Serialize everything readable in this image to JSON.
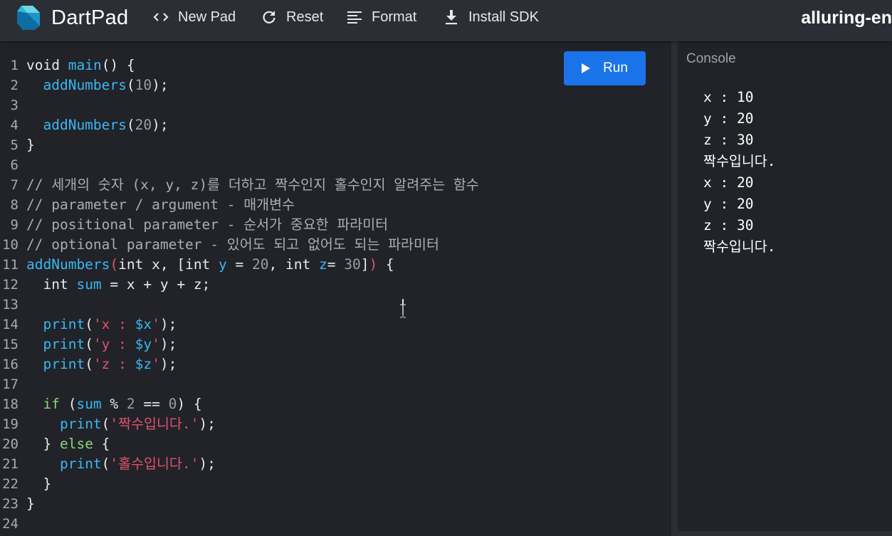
{
  "app": {
    "title": "DartPad",
    "pad_name": "alluring-en"
  },
  "toolbar": {
    "new_pad_label": "New Pad",
    "reset_label": "Reset",
    "format_label": "Format",
    "install_sdk_label": "Install SDK"
  },
  "editor": {
    "run_label": "Run",
    "lines": [
      [
        [
          "void",
          "kw-plain"
        ],
        [
          " ",
          ""
        ],
        [
          "main",
          "fn"
        ],
        [
          "() {",
          ""
        ]
      ],
      [
        [
          "  ",
          ""
        ],
        [
          "addNumbers",
          "fn"
        ],
        [
          "(",
          ""
        ],
        [
          "10",
          "num"
        ],
        [
          ");",
          ""
        ]
      ],
      [],
      [
        [
          "  ",
          ""
        ],
        [
          "addNumbers",
          "fn"
        ],
        [
          "(",
          ""
        ],
        [
          "20",
          "num"
        ],
        [
          ");",
          ""
        ]
      ],
      [
        [
          "}",
          ""
        ]
      ],
      [],
      [
        [
          "// 세개의 숫자 (x, y, z)를 더하고 짝수인지 홀수인지 알려주는 함수",
          "cm"
        ]
      ],
      [
        [
          "// parameter / argument - 매개변수",
          "cm"
        ]
      ],
      [
        [
          "// positional parameter - 순서가 중요한 파라미터",
          "cm"
        ]
      ],
      [
        [
          "// optional parameter - 있어도 되고 없어도 되는 파라미터",
          "cm"
        ]
      ],
      [
        [
          "addNumbers",
          "fn"
        ],
        [
          "(",
          "paren"
        ],
        [
          "int x, [int ",
          ""
        ],
        [
          "y",
          "var"
        ],
        [
          " = ",
          ""
        ],
        [
          "20",
          "num"
        ],
        [
          ", int ",
          ""
        ],
        [
          "z",
          "var"
        ],
        [
          "= ",
          ""
        ],
        [
          "30",
          "num"
        ],
        [
          "]",
          ""
        ],
        [
          ")",
          "paren"
        ],
        [
          " {",
          ""
        ]
      ],
      [
        [
          "  int ",
          ""
        ],
        [
          "sum",
          "var"
        ],
        [
          " = x + y + z;",
          ""
        ]
      ],
      [],
      [
        [
          "  ",
          ""
        ],
        [
          "print",
          "fn"
        ],
        [
          "(",
          ""
        ],
        [
          "'x : ",
          "str"
        ],
        [
          "$x",
          "var"
        ],
        [
          "'",
          "str"
        ],
        [
          ");",
          ""
        ]
      ],
      [
        [
          "  ",
          ""
        ],
        [
          "print",
          "fn"
        ],
        [
          "(",
          ""
        ],
        [
          "'y : ",
          "str"
        ],
        [
          "$y",
          "var"
        ],
        [
          "'",
          "str"
        ],
        [
          ");",
          ""
        ]
      ],
      [
        [
          "  ",
          ""
        ],
        [
          "print",
          "fn"
        ],
        [
          "(",
          ""
        ],
        [
          "'z : ",
          "str"
        ],
        [
          "$z",
          "var"
        ],
        [
          "'",
          "str"
        ],
        [
          ");",
          ""
        ]
      ],
      [],
      [
        [
          "  ",
          ""
        ],
        [
          "if",
          "kw"
        ],
        [
          " (",
          ""
        ],
        [
          "sum",
          "var"
        ],
        [
          " % ",
          ""
        ],
        [
          "2",
          "num"
        ],
        [
          " == ",
          ""
        ],
        [
          "0",
          "num"
        ],
        [
          ") {",
          ""
        ]
      ],
      [
        [
          "    ",
          ""
        ],
        [
          "print",
          "fn"
        ],
        [
          "(",
          ""
        ],
        [
          "'짝수입니다.'",
          "str"
        ],
        [
          ");",
          ""
        ]
      ],
      [
        [
          "  } ",
          ""
        ],
        [
          "else",
          "kw"
        ],
        [
          " {",
          ""
        ]
      ],
      [
        [
          "    ",
          ""
        ],
        [
          "print",
          "fn"
        ],
        [
          "(",
          ""
        ],
        [
          "'홀수입니다.'",
          "str"
        ],
        [
          ");",
          ""
        ]
      ],
      [
        [
          "  }",
          ""
        ]
      ],
      [
        [
          "}",
          ""
        ]
      ],
      []
    ]
  },
  "console": {
    "title": "Console",
    "output": [
      "x : 10",
      "y : 20",
      "z : 30",
      "짝수입니다.",
      "x : 20",
      "y : 20",
      "z : 30",
      "짝수입니다."
    ]
  },
  "colors": {
    "run_button": "#1a73e8",
    "keyword": "#8fd27a",
    "function": "#3ab7f2",
    "string": "#e0516d",
    "number": "#9a9ea7"
  },
  "icons": {
    "logo": "dart-logo-icon",
    "new_pad": "code-brackets-icon",
    "reset": "refresh-icon",
    "format": "format-lines-icon",
    "install_sdk": "download-icon",
    "run": "play-icon"
  }
}
